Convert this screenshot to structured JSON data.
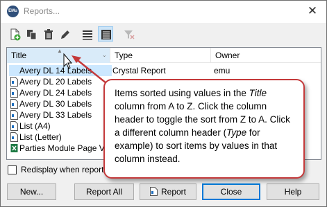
{
  "window": {
    "title": "Reports...",
    "app_icon_text": "EMu",
    "close_glyph": "✕"
  },
  "toolbar": {
    "buttons": [
      {
        "name": "new-report-icon"
      },
      {
        "name": "copy-report-icon"
      },
      {
        "name": "delete-icon"
      },
      {
        "name": "edit-icon"
      },
      {
        "name": "list-view-icon"
      },
      {
        "name": "details-view-icon",
        "active": true
      },
      {
        "name": "filter-clear-icon",
        "disabled": true
      }
    ]
  },
  "list": {
    "columns": [
      {
        "label": "Title",
        "sorted": true
      },
      {
        "label": "Type"
      },
      {
        "label": "Owner"
      }
    ],
    "rows": [
      {
        "title": "Avery DL 14 Labels",
        "type": "Crystal Report",
        "owner": "emu",
        "selected": true
      },
      {
        "title": "Avery DL 20 Labels",
        "type": "",
        "owner": ""
      },
      {
        "title": "Avery DL 24 Labels",
        "type": "",
        "owner": ""
      },
      {
        "title": "Avery DL 30 Labels",
        "type": "",
        "owner": ""
      },
      {
        "title": "Avery DL 33 Labels",
        "type": "",
        "owner": ""
      },
      {
        "title": "List (A4)",
        "type": "",
        "owner": ""
      },
      {
        "title": "List (Letter)",
        "type": "",
        "owner": ""
      },
      {
        "title": "Parties Module Page View",
        "type": "",
        "owner": "",
        "excel": true
      }
    ]
  },
  "redisplay": {
    "label": "Redisplay when report has",
    "checked": false
  },
  "buttons": {
    "new": "New...",
    "report_all": "Report All",
    "report": "Report",
    "close": "Close",
    "help": "Help"
  },
  "callout": {
    "part1": "Items sorted using values in the ",
    "title_word": "Title",
    "part2": " column from A to Z. Click the column header to toggle the sort from Z to A. Click a different column header (",
    "type_word": "Type",
    "part3": " for example) to sort items by values in that column instead."
  },
  "colors": {
    "callout_border": "#c4393a",
    "selection": "#cce8ff",
    "sorted_header": "#d9ebf9",
    "accent": "#0078d7"
  }
}
